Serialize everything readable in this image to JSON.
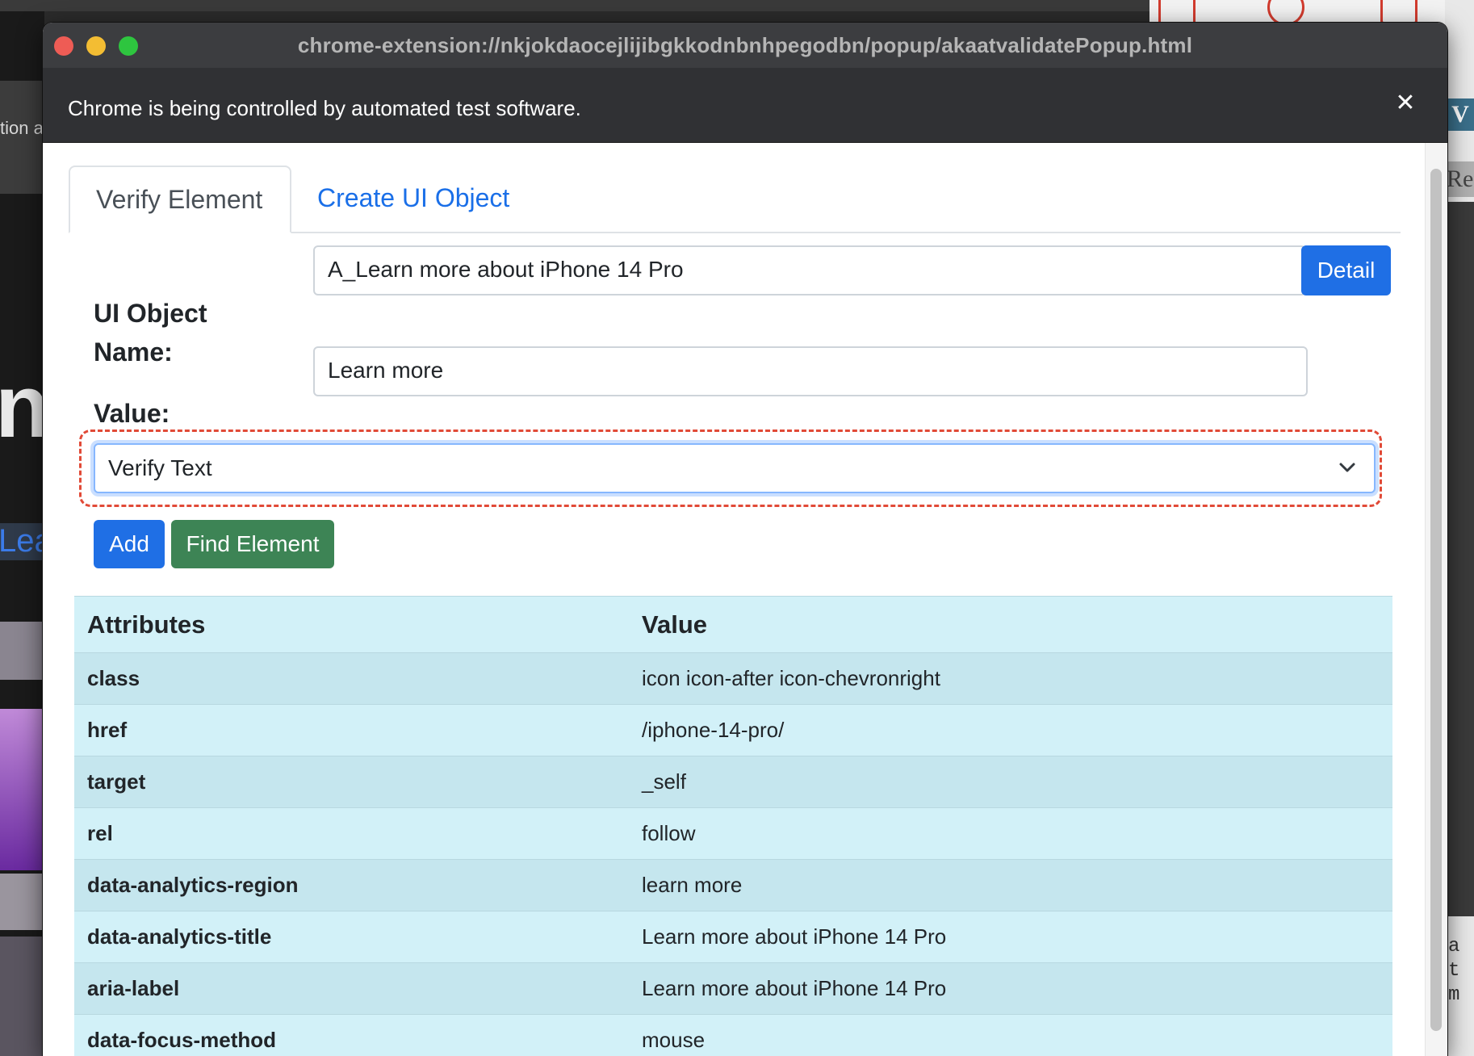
{
  "window": {
    "url": "chrome-extension://nkjokdaocejlijibgkkodnbnhpegodbn/popup/akaatvalidatePopup.html"
  },
  "infobar": {
    "message": "Chrome is being controlled by automated test software.",
    "close_icon": "close-icon"
  },
  "background": {
    "left_text": "tion a",
    "left_big": "nc",
    "left_link": "Lea",
    "right_v": "V",
    "right_re": "Re",
    "right_code": "a\nt\nm"
  },
  "tabs": [
    {
      "label": "Verify Element",
      "active": true
    },
    {
      "label": "Create UI Object",
      "active": false
    }
  ],
  "form": {
    "ui_object_name_label": "UI Object Name:",
    "ui_object_name_value": "A_Learn more about iPhone 14 Pro",
    "detail_button": "Detail",
    "value_label": "Value:",
    "value_value": "Learn more",
    "verify_select": "Verify Text",
    "add_button": "Add",
    "find_button": "Find Element"
  },
  "table": {
    "headers": [
      "Attributes",
      "Value"
    ],
    "rows": [
      {
        "key": "class",
        "value": "icon icon-after icon-chevronright"
      },
      {
        "key": "href",
        "value": "/iphone-14-pro/"
      },
      {
        "key": "target",
        "value": "_self"
      },
      {
        "key": "rel",
        "value": "follow"
      },
      {
        "key": "data-analytics-region",
        "value": "learn more"
      },
      {
        "key": "data-analytics-title",
        "value": "Learn more about iPhone 14 Pro"
      },
      {
        "key": "aria-label",
        "value": "Learn more about iPhone 14 Pro"
      },
      {
        "key": "data-focus-method",
        "value": "mouse"
      }
    ]
  },
  "colors": {
    "primary": "#1f6fe5",
    "success": "#3d8455",
    "table_bg": "#d2f1f8",
    "highlight": "#e14a37"
  }
}
